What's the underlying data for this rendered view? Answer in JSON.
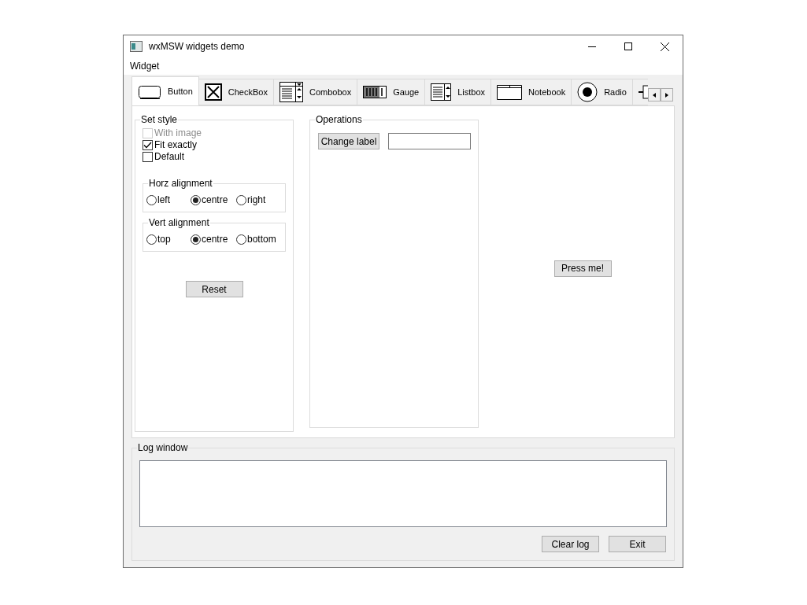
{
  "window": {
    "title": "wxMSW widgets demo"
  },
  "menu": [
    "Widget"
  ],
  "tabs": [
    {
      "label": "Button",
      "kind": "button",
      "selected": true
    },
    {
      "label": "CheckBox",
      "kind": "checkbox",
      "selected": false
    },
    {
      "label": "Combobox",
      "kind": "combobox",
      "selected": false
    },
    {
      "label": "Gauge",
      "kind": "gauge",
      "selected": false
    },
    {
      "label": "Listbox",
      "kind": "listbox",
      "selected": false
    },
    {
      "label": "Notebook",
      "kind": "notebook",
      "selected": false
    },
    {
      "label": "Radio",
      "kind": "radio",
      "selected": false
    },
    {
      "kind": "slider",
      "selected": false
    }
  ],
  "set_style": {
    "title": "Set style",
    "checkboxes": [
      {
        "label": "With image",
        "checked": false,
        "disabled": true
      },
      {
        "label": "Fit exactly",
        "checked": true,
        "disabled": false
      },
      {
        "label": "Default",
        "checked": false,
        "disabled": false
      }
    ],
    "groups": [
      {
        "title": "Horz alignment",
        "options": [
          {
            "label": "left",
            "selected": false
          },
          {
            "label": "centre",
            "selected": true
          },
          {
            "label": "right",
            "selected": false
          }
        ]
      },
      {
        "title": "Vert alignment",
        "options": [
          {
            "label": "top",
            "selected": false
          },
          {
            "label": "centre",
            "selected": true
          },
          {
            "label": "bottom",
            "selected": false
          }
        ]
      }
    ],
    "reset_button": "Reset"
  },
  "operations": {
    "title": "Operations",
    "button": "Change label"
  },
  "press_button": "Press me!",
  "log": {
    "title": "Log window",
    "buttons": [
      "Clear log",
      "Exit"
    ]
  }
}
